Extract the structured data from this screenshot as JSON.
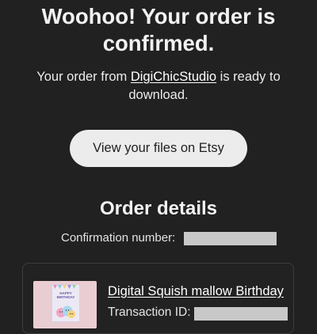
{
  "confirmation": {
    "headline": "Woohoo! Your order is confirmed.",
    "message_before": "Your order from ",
    "shop_name": "DigiChicStudio",
    "message_after": " is ready to download.",
    "view_files_button": "View your files on Etsy"
  },
  "order_details": {
    "title": "Order details",
    "confirmation_label": "Confirmation number:",
    "confirmation_value_redacted": true,
    "item": {
      "title": "Digital Squish mallow Birthday",
      "thumbnail_text": "HAPPY BIRTHDAY",
      "transaction_label": "Transaction ID:",
      "transaction_value_redacted": true
    }
  },
  "colors": {
    "background": "#212121",
    "button_background": "#ececec",
    "redaction": "#c8c8c8",
    "card_border": "#3d3d3d"
  }
}
